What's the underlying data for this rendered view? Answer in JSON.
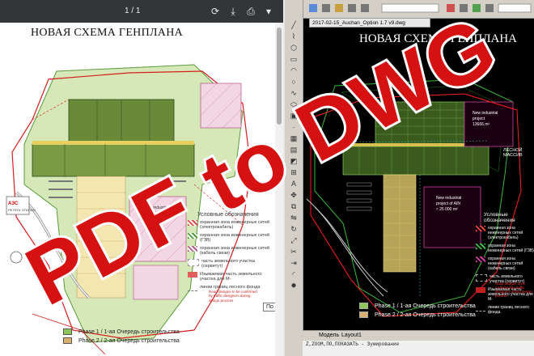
{
  "pdf_viewer": {
    "page_indicator": "1 / 1",
    "title": "НОВАЯ СХЕМА ГЕНПЛАНА",
    "fit_tooltip": "По размеру страницы",
    "gas_station": {
      "brand": "АЗС",
      "sub": "PETROL STATION"
    },
    "building_label": [
      "New industrial",
      "project of AIN",
      "≈ 25 000 m²"
    ],
    "legend_title": "Условные обозначения",
    "legend_items": [
      "охранная зона инженерных сетей (электрокабель)",
      "охранная зона инженерных сетей (ГЗВ)",
      "охранная зона инженерных сетей (кабель связи)",
      "часть земельного участка (сервитут)",
      "Изымаемая часть земельного участка для М-",
      "линии границ лесного фонда"
    ],
    "red_note": "Road designs to be confirmed by traffic designers during design process",
    "phases": [
      {
        "label": "Phase 1 / 1-ая Очередь строительства",
        "color": "#8fc65a"
      },
      {
        "label": "Phase 2 / 2-ая Очередь строительства",
        "color": "#d9b070"
      }
    ]
  },
  "cad_window": {
    "tab_title": "2017-02-15_Auchan_Option 1.7 v9.dwg",
    "title": "НОВАЯ СХЕМА ГЕНПЛАНА",
    "forest_label": "ЛЕСНОЙ МАССИВ",
    "buildings": [
      [
        "New industrial",
        "project",
        "13666 m²"
      ],
      [
        "New industrial",
        "project of AIN",
        "≈ 25 000 m²"
      ]
    ],
    "legend_title": "Условные обозначения",
    "legend_items": [
      "охранная зона инженерных сетей (электрокабель)",
      "охранная зона инженерных сетей (ГЗВ)",
      "охранная зона инженерных сетей (кабель связи)",
      "часть земельного участка (сервитут)",
      "Изымаемая часть земельного участка для М-",
      "линии границ лесного фонда"
    ],
    "red_note": "Road designs to be confirmed by traffic designers during design process",
    "phases": [
      {
        "label": "Phase 1 / 1-ая Очередь строительства",
        "color": "#8fc65a"
      },
      {
        "label": "Phase 2 / 2-ая Очередь строительства",
        "color": "#d9b070"
      }
    ],
    "layout_tabs": {
      "model": "Модель",
      "layout": "Layout1"
    },
    "command_lines": [
      "Z,ZOOM,ПО,ПОКАЗАТЬ - Зумирование"
    ]
  },
  "overlay": {
    "text": "PDF to DWG",
    "fill_color": "#d51111",
    "outline_color": "#ffffff"
  }
}
